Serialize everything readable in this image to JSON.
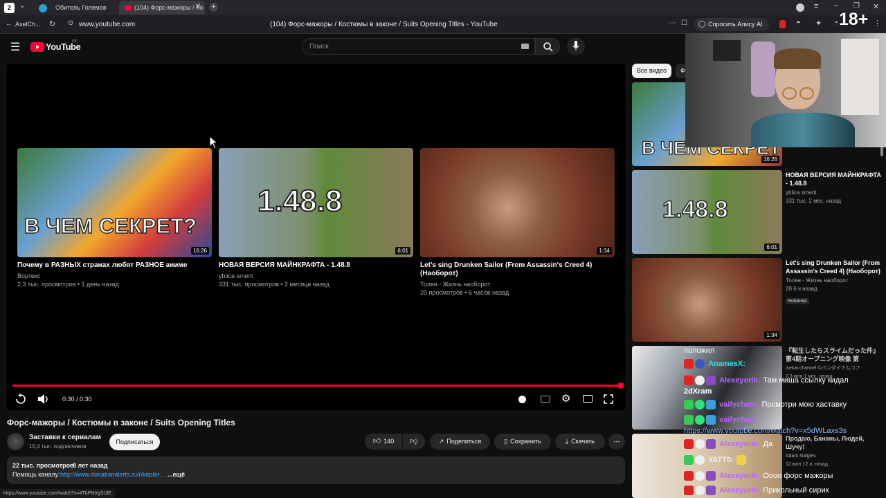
{
  "browser": {
    "tab_count": "2",
    "tabs": [
      {
        "title": "Обитель Големов"
      },
      {
        "title": "(104) Форс-мажоры / Ко"
      }
    ],
    "back_label": "AxelCh...",
    "url": "www.youtube.com",
    "page_title": "(104) Форс-мажоры / Костюмы в законе / Suits Opening Titles - YouTube",
    "alice_label": "Спросить Алису AI"
  },
  "overlay": {
    "age": "18+"
  },
  "youtube": {
    "logo": "YouTube",
    "region": "LV",
    "search_placeholder": "Поиск"
  },
  "player": {
    "time": "0:30 / 0:30",
    "progress": 1.0,
    "end_cards": [
      {
        "title": "Почему в РАЗНЫХ странах любят РАЗНОЕ аниме",
        "channel": "Вортекс",
        "stats": "2,3 тыс. просмотров • 1 день назад",
        "duration": "16:26",
        "thumb_text": "В ЧЕМ СЕКРЕТ?"
      },
      {
        "title": "НОВАЯ ВЕРСИЯ МАЙНКРАФТА - 1.48.8",
        "channel": "ybiica smerti",
        "stats": "331 тыс. просмотров • 2 месяца назад",
        "duration": "6:01",
        "thumb_text": "1.48.8"
      },
      {
        "title": "Let's sing Drunken Sailor (From Assassin's Creed 4) (Наоборот)",
        "channel": "Толян - Жизнь наоборот",
        "stats": "20 просмотров • 6 часов назад",
        "duration": "1:34"
      }
    ]
  },
  "video": {
    "title": "Форс-мажоры / Костюмы в законе / Suits Opening Titles",
    "channel": "Заставки к сериалам",
    "subscribers": "10,4 тыс. подписчиков",
    "subscribe": "Подписаться",
    "likes": "140",
    "share": "Поделиться",
    "save": "Сохранить",
    "download": "Скачать",
    "views": "22 тыс. просмотров",
    "age": "8 лет назад",
    "desc_prefix": "Помощь каналу:",
    "desc_link": "http://www.donationalerts.ru/r/kepler...",
    "more": "...ещё",
    "status_url": "https://www.youtube.com/watch?v=4TbPNVgSUlE"
  },
  "sidebar": {
    "chip": "Все видео",
    "chip2": "Ф",
    "items": [
      {
        "duration": "16:26",
        "thumb_text": "В ЧЕМ СЕКРЕТ"
      },
      {
        "title": "НОВАЯ ВЕРСИЯ МАЙНКРАФТА - 1.48.8",
        "channel": "ybiica smerti",
        "stats": "331 тыс.  2 мес. назад",
        "duration": "6:01",
        "thumb_text": "1.48.8"
      },
      {
        "title": "Let's sing Drunken Sailor (From Assassin's Creed 4) (Наоборот)",
        "channel": "Толян - Жизнь наоборот",
        "stats": "20  6 ч назад",
        "badge": "Новинка",
        "duration": "1:34"
      },
      {
        "title": "『転生したらスライムだった件』第4期オープニング映像 第",
        "channel": "isekai channel ©バンダイナムコフ",
        "stats": "2,3 млн  1 мес. назад"
      },
      {
        "title": "Продаю, Бананы, Людей, Шучу!",
        "channel": "Adam Nalgiev",
        "stats": "12 млн  12 л. назад"
      }
    ]
  },
  "chat": [
    {
      "user": "",
      "text": "положил"
    },
    {
      "user": "AnamesX:",
      "text": ""
    },
    {
      "user": "Alexeyorik:",
      "text": "Там миша ссылку кидал"
    },
    {
      "user": "",
      "text": "2dXram"
    },
    {
      "user": "vaifychaty:",
      "text": "Посмотри мою хаставку"
    },
    {
      "user": "vaifychaty:",
      "text": "https://www.youtube.com/watch?v=x5dWLaxs3s"
    },
    {
      "user": "Alexeyorik:",
      "text": "Да"
    },
    {
      "user": "YATT0:",
      "text": ""
    },
    {
      "user": "Alexeyorik:",
      "text": "Оооо форс мажоры"
    },
    {
      "user": "Alexeyorik:",
      "text": "Прикольный сирик"
    }
  ],
  "colors": {
    "red": "#ff0033",
    "bg": "#0f0f0f",
    "chip": "#272727",
    "user_purple": "#b565ff",
    "user_teal": "#2ee3e0",
    "link": "#3ea6ff"
  }
}
